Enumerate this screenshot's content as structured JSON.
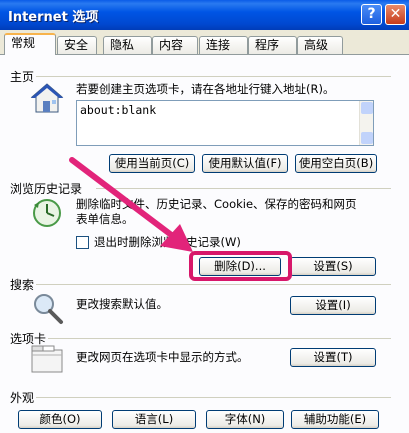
{
  "window": {
    "title": "Internet 选项",
    "help": "?",
    "close": "✕"
  },
  "tabs": [
    "常规",
    "安全",
    "隐私",
    "内容",
    "连接",
    "程序",
    "高级"
  ],
  "home": {
    "label": "主页",
    "desc": "若要创建主页选项卡，请在各地址行键入地址(R)。",
    "url": "about:blank",
    "btn_current": "使用当前页(C)",
    "btn_default": "使用默认值(F)",
    "btn_blank": "使用空白页(B)"
  },
  "history": {
    "label": "浏览历史记录",
    "desc_line1": "删除临时文件、历史记录、Cookie、保存的密码和网页",
    "desc_line2": "表单信息。",
    "checkbox_label": "退出时删除浏览历史记录(W)",
    "btn_delete": "删除(D)...",
    "btn_settings": "设置(S)"
  },
  "search": {
    "label": "搜索",
    "desc": "更改搜索默认值。",
    "btn_settings": "设置(I)"
  },
  "tabsec": {
    "label": "选项卡",
    "desc": "更改网页在选项卡中显示的方式。",
    "btn_settings": "设置(T)"
  },
  "appearance": {
    "label": "外观",
    "btn_colors": "颜色(O)",
    "btn_languages": "语言(L)",
    "btn_fonts": "字体(N)",
    "btn_accessibility": "辅助功能(E)"
  }
}
